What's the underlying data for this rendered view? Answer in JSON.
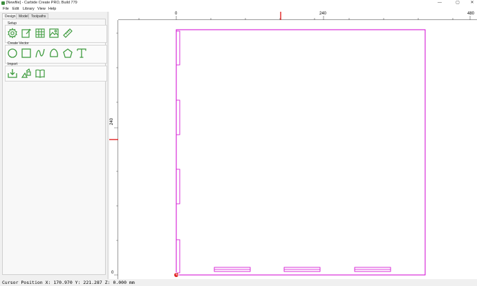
{
  "window": {
    "title": "[Newfile] - Carbide Create PRO, Build 779",
    "minimize_glyph": "—",
    "maximize_glyph": "▢",
    "close_glyph": "✕"
  },
  "menu": [
    "File",
    "Edit",
    "Library",
    "View",
    "Help"
  ],
  "tabs": [
    "Design",
    "Model",
    "Toolpaths"
  ],
  "groups": {
    "setup": "Setup",
    "create_vector": "Create Vector",
    "import": "Import"
  },
  "tools": {
    "setup": [
      "gear-icon",
      "edit-document-icon",
      "grid-icon",
      "image-icon",
      "ruler-icon"
    ],
    "create_vector": [
      "circle-icon",
      "rectangle-icon",
      "curve-icon",
      "polygon-blob-icon",
      "pentagon-icon",
      "text-icon"
    ],
    "import": [
      "import-icon",
      "import-shapes-icon",
      "library-book-icon"
    ]
  },
  "ruler": {
    "h_labels": [
      "0",
      "240",
      "480"
    ],
    "v_labels": [
      "240",
      "0"
    ]
  },
  "status": {
    "text": "Cursor Position X: 170.970 Y: 221.287 Z: 0.000 mm"
  },
  "colors": {
    "stock_outline": "#d000d0",
    "tool_icon": "#3c9a3c",
    "cursor_marker": "#e02020"
  }
}
